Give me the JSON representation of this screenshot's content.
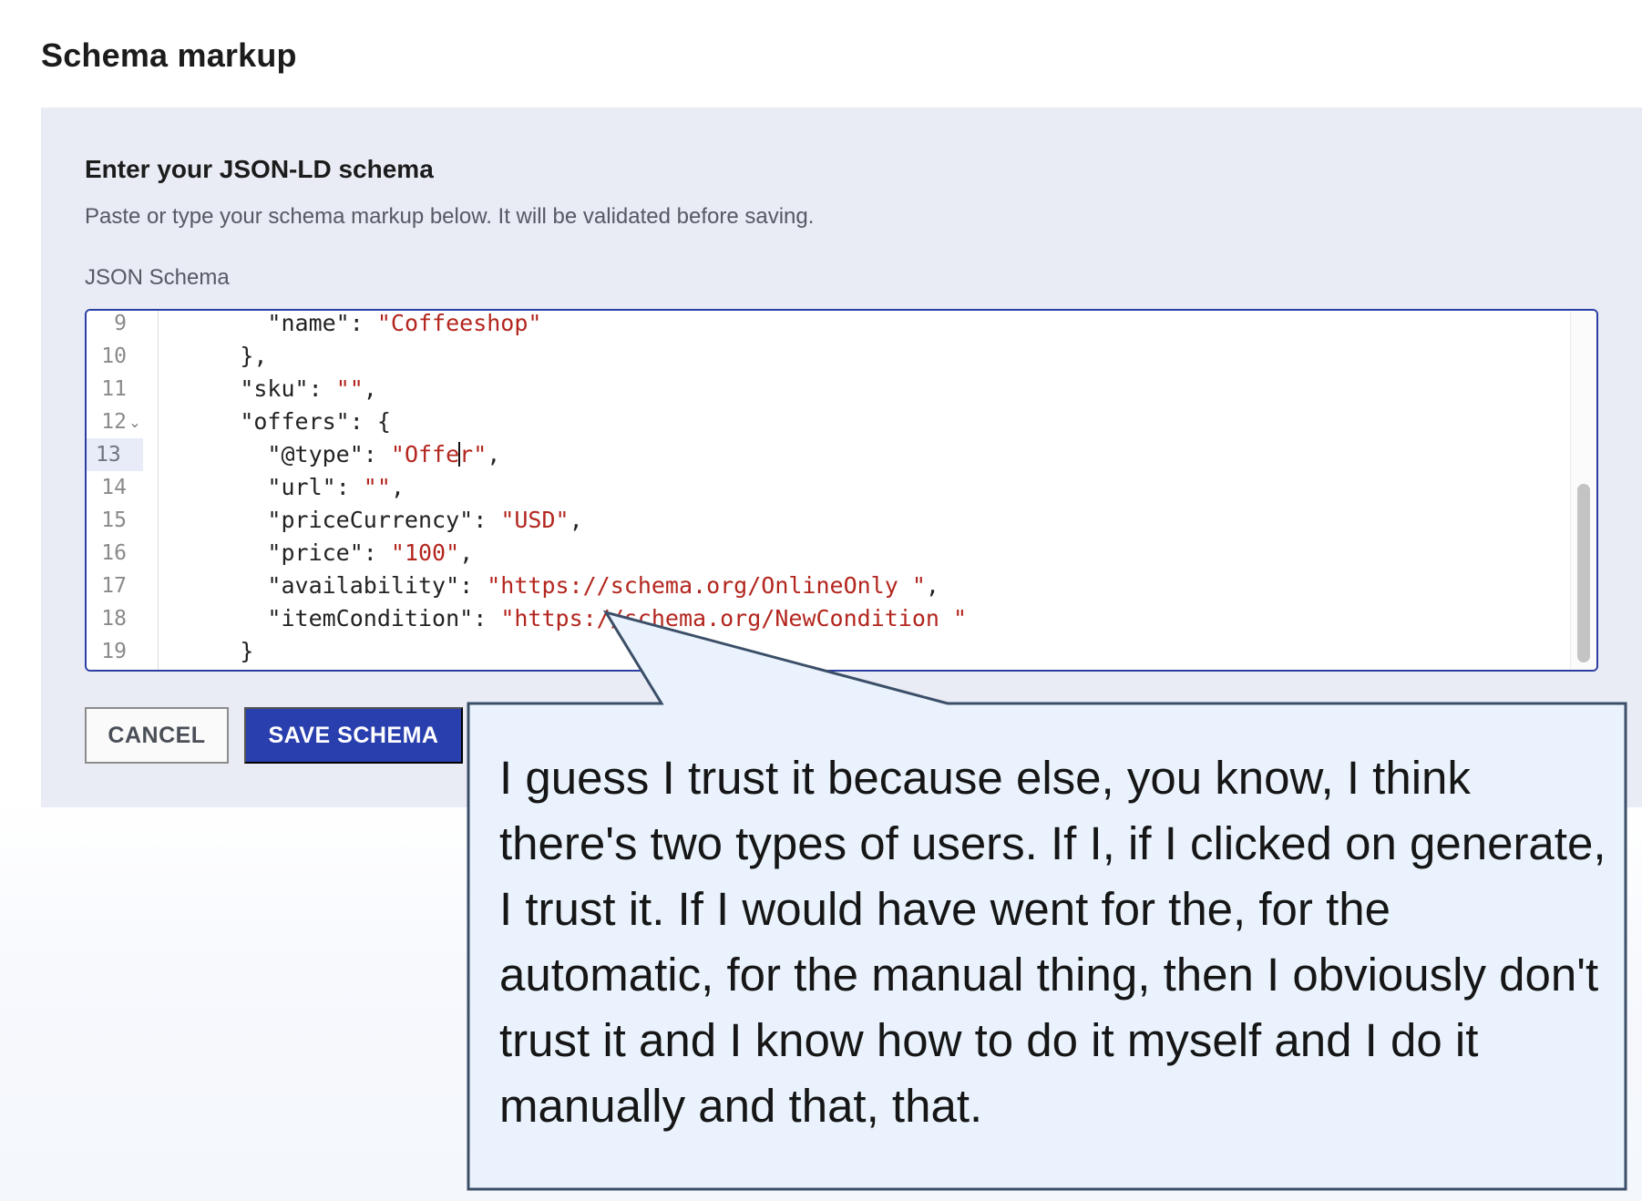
{
  "page": {
    "title": "Schema markup"
  },
  "form": {
    "heading": "Enter your JSON-LD schema",
    "description": "Paste or type your schema markup below. It will be validated before saving.",
    "field_label": "JSON Schema",
    "cancel_label": "CANCEL",
    "save_label": "SAVE SCHEMA"
  },
  "editor": {
    "active_line": 13,
    "lines": [
      {
        "no": "9",
        "key": "\"name\"",
        "value": "\"Coffeeshop\"",
        "suffix": ""
      },
      {
        "no": "10",
        "plain": "},"
      },
      {
        "no": "11",
        "key": "\"sku\"",
        "value": "\"\"",
        "suffix": ","
      },
      {
        "no": "12",
        "key": "\"offers\"",
        "plain_after": "{",
        "foldable": true
      },
      {
        "no": "13",
        "key": "\"@type\"",
        "value_before_cursor": "\"Offe",
        "value_after_cursor": "r\"",
        "suffix": ","
      },
      {
        "no": "14",
        "key": "\"url\"",
        "value": "\"\"",
        "suffix": ","
      },
      {
        "no": "15",
        "key": "\"priceCurrency\"",
        "value": "\"USD\"",
        "suffix": ","
      },
      {
        "no": "16",
        "key": "\"price\"",
        "value": "\"100\"",
        "suffix": ","
      },
      {
        "no": "17",
        "key": "\"availability\"",
        "value": "\"https://schema.org/OnlineOnly \"",
        "suffix": ","
      },
      {
        "no": "18",
        "key": "\"itemCondition\"",
        "value": "\"https://schema.org/NewCondition \"",
        "suffix": ""
      },
      {
        "no": "19",
        "plain": "}"
      }
    ],
    "fold_icon": "chevron-down-icon"
  },
  "callout": {
    "text": "I guess I trust it because else, you know, I think there's two types of users. If I, if I clicked on generate, I trust it. If I would have went for the, for the automatic, for the manual thing, then I obviously don't trust it and I know how to do it myself and I do it manually and that, that.",
    "background": "#eaf3fd",
    "border": "#3c4f68"
  },
  "colors": {
    "accent": "#2a3fae",
    "panel": "#e9ebf5",
    "string": "#b3261e"
  }
}
